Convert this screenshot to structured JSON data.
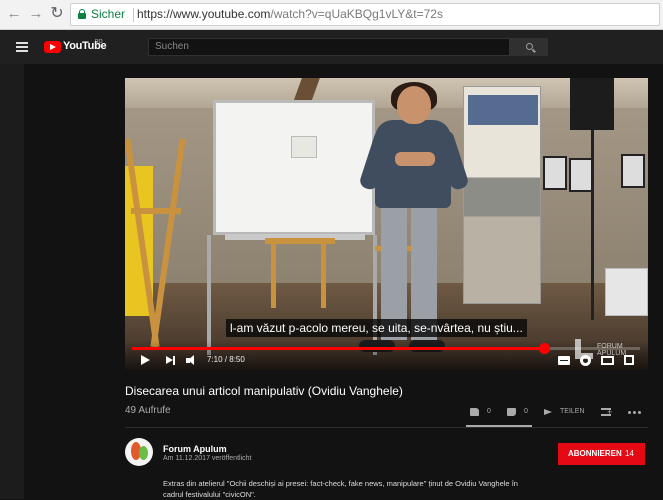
{
  "browser": {
    "secure_label": "Sicher",
    "url_host": "https://www.youtube.com",
    "url_path": "/watch?v=qUaKBQg1vLY&t=72s"
  },
  "header": {
    "logo_text": "YouTube",
    "logo_region": "RO",
    "search_placeholder": "Suchen"
  },
  "player": {
    "subtitle": "l-am văzut p-acolo mereu, se uita, se-nvârtea, nu știu...",
    "time": "7:10 / 8:50",
    "progress_fraction": 0.811,
    "watermark_line1": "FORUM",
    "watermark_line2": "APULUM"
  },
  "video": {
    "title": "Disecarea unui articol manipulativ (Ovidiu Vanghele)",
    "views": "49 Aufrufe",
    "likes": "0",
    "dislikes": "0",
    "share_label": "TEILEN"
  },
  "channel": {
    "name": "Forum Apulum",
    "published": "Am 11.12.2017 veröffentlicht",
    "subscribe_label": "ABONNIEREN",
    "subscriber_count": "14"
  },
  "description": {
    "text": "Extras din atelierul \"Ochii deschiși ai presei: fact-check, fake news, manipulare\" ținut de Ovidiu Vanghele în cadrul festivalului \"civicON\"."
  },
  "icons": {
    "back": "arrow-left-icon",
    "forward": "arrow-right-icon",
    "reload": "reload-icon",
    "lock": "lock-icon",
    "menu": "hamburger-menu-icon",
    "search": "search-icon",
    "play": "play-icon",
    "next": "next-icon",
    "volume": "volume-icon",
    "captions": "captions-icon",
    "settings": "gear-icon",
    "theater": "theater-mode-icon",
    "fullscreen": "fullscreen-icon",
    "like": "thumb-up-icon",
    "dislike": "thumb-down-icon",
    "share": "share-icon",
    "add_to": "add-to-playlist-icon",
    "more": "more-icon"
  },
  "colors": {
    "accent": "#ff0000",
    "subscribe": "#e50914",
    "background": "#121212",
    "secure": "#0b8043"
  }
}
